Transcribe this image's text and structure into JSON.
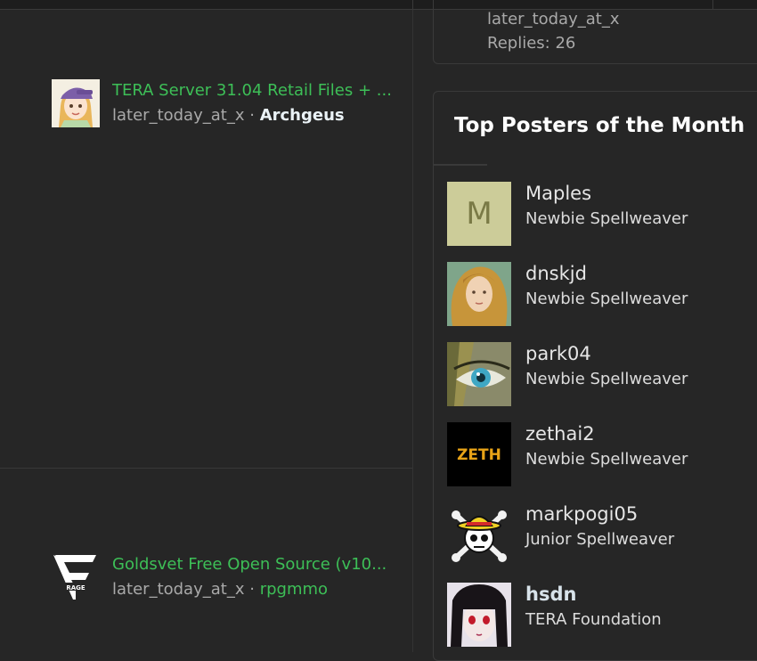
{
  "threads": [
    {
      "title": "TERA Server 31.04 Retail Files + ...",
      "author": "later_today_at_x",
      "separator": "·",
      "forum": "Archgeus"
    },
    {
      "title": "Goldsvet Free Open Source (v10...",
      "author": "later_today_at_x",
      "separator": "·",
      "forum": "rpgmmo"
    }
  ],
  "top_card": {
    "author": "later_today_at_x",
    "replies": "Replies: 26"
  },
  "top_posters": {
    "heading": "Top Posters of the Month",
    "items": [
      {
        "name": "Maples",
        "rank": "Newbie Spellweaver",
        "avatar_letter": "M"
      },
      {
        "name": "dnskjd",
        "rank": "Newbie Spellweaver"
      },
      {
        "name": "park04",
        "rank": "Newbie Spellweaver"
      },
      {
        "name": "zethai2",
        "rank": "Newbie Spellweaver",
        "avatar_text": "ZETH"
      },
      {
        "name": "markpogi05",
        "rank": "Junior Spellweaver"
      },
      {
        "name": "hsdn",
        "rank": "TERA Foundation"
      }
    ]
  },
  "logo_text": "RAGE",
  "colors": {
    "background": "#262626",
    "link_green": "#3dbf57",
    "avatar_m_bg": "#cccc99"
  }
}
